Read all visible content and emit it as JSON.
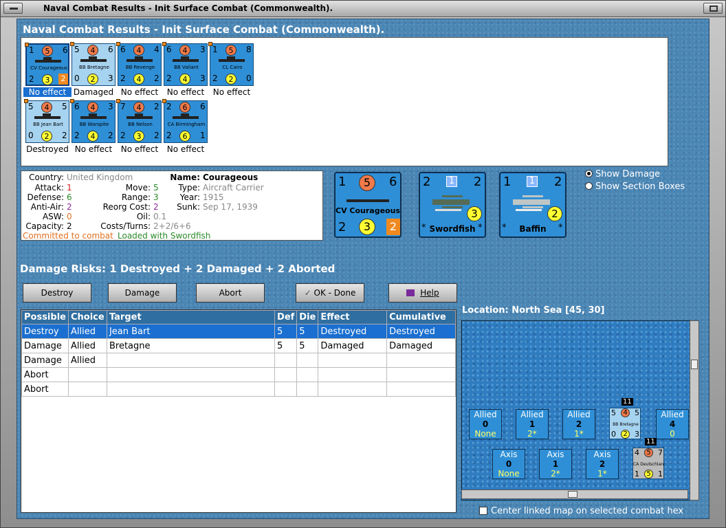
{
  "window": {
    "title": "Naval Combat Results - Init Surface Combat (Commonwealth)."
  },
  "panel_title": "Naval Combat Results - Init Surface Combat (Commonwealth).",
  "units": [
    {
      "tl": "1",
      "top": "5",
      "tr": "6",
      "name": "CV Courageous",
      "bl": "2",
      "mid": "3",
      "br": "2",
      "result": "No effect",
      "selected": true,
      "light": false
    },
    {
      "tl": "5",
      "top": "4",
      "tr": "6",
      "name": "BB Bretagne",
      "bl": "0",
      "mid": "2",
      "br": "3",
      "result": "Damaged",
      "selected": false,
      "light": true
    },
    {
      "tl": "6",
      "top": "4",
      "tr": "4",
      "name": "BB Revenge",
      "bl": "2",
      "mid": "4",
      "br": "2",
      "result": "No effect",
      "selected": false,
      "light": false
    },
    {
      "tl": "6",
      "top": "4",
      "tr": "3",
      "name": "BB Valiant",
      "bl": "2",
      "mid": "4",
      "br": "3",
      "result": "No effect",
      "selected": false,
      "light": false
    },
    {
      "tl": "1",
      "top": "5",
      "tr": "8",
      "name": "CL Cairo",
      "bl": "2",
      "mid": "2",
      "br": "0",
      "result": "No effect",
      "selected": false,
      "light": false
    },
    {
      "tl": "5",
      "top": "4",
      "tr": "5",
      "name": "BB Jean Bart",
      "bl": "0",
      "mid": "2",
      "br": "2",
      "result": "Destroyed",
      "selected": false,
      "light": true
    },
    {
      "tl": "6",
      "top": "4",
      "tr": "3",
      "name": "BB Warspite",
      "bl": "2",
      "mid": "4",
      "br": "2",
      "result": "No effect",
      "selected": false,
      "light": false
    },
    {
      "tl": "7",
      "top": "4",
      "tr": "2",
      "name": "BB Nelson",
      "bl": "2",
      "mid": "3",
      "br": "2",
      "result": "No effect",
      "selected": false,
      "light": false
    },
    {
      "tl": "2",
      "top": "6",
      "tr": "6",
      "name": "CA Birmingham",
      "bl": "2",
      "mid": "6",
      "br": "1",
      "result": "No effect",
      "selected": false,
      "light": false
    }
  ],
  "info": {
    "country_label": "Country:",
    "country": "United Kingdom",
    "attack_label": "Attack:",
    "attack": "1",
    "defense_label": "Defense:",
    "defense": "6",
    "antiair_label": "Anti-Air:",
    "antiair": "2",
    "asw_label": "ASW:",
    "asw": "0",
    "capacity_label": "Capacity:",
    "capacity": "2",
    "name_label": "Name:",
    "name": "Courageous",
    "move_label": "Move:",
    "move": "5",
    "type_label": "Type:",
    "type": "Aircraft Carrier",
    "range_label": "Range:",
    "range": "3",
    "year_label": "Year:",
    "year": "1915",
    "reorg_label": "Reorg Cost:",
    "reorg": "2",
    "sunk_label": "Sunk:",
    "sunk": "Sep 17, 1939",
    "oil_label": "Oil:",
    "oil": "0.1",
    "costs_label": "Costs/Turns:",
    "costs": "2+2/6+6",
    "status_committed": "Committed to combat",
    "status_loaded": "Loaded with Swordfish"
  },
  "big_cards": {
    "ship": {
      "tl": "1",
      "top": "5",
      "tr": "6",
      "name": "CV Courageous",
      "bl": "2",
      "mid": "3",
      "br": "2"
    },
    "plane1": {
      "tl": "2",
      "top": "1",
      "tr": "2",
      "name": "Swordfish",
      "mid": "3",
      "bl": "*",
      "br": "*"
    },
    "plane2": {
      "tl": "1",
      "top": "1",
      "tr": "2",
      "name": "Baffin",
      "mid": "2",
      "bl": "*",
      "br": "*"
    }
  },
  "options": {
    "show_damage": "Show Damage",
    "show_section_boxes": "Show Section Boxes",
    "selected": "show_damage"
  },
  "risks": "Damage Risks: 1 Destroyed + 2 Damaged + 2 Aborted",
  "buttons": {
    "destroy": "Destroy",
    "damage": "Damage",
    "abort": "Abort",
    "ok": "OK - Done",
    "help": "Help"
  },
  "table": {
    "headers": [
      "Possible",
      "Choice",
      "Target",
      "Def",
      "Die",
      "Effect",
      "Cumulative"
    ],
    "rows": [
      [
        "Destroy",
        "Allied",
        "Jean Bart",
        "5",
        "5",
        "Destroyed",
        "Destroyed"
      ],
      [
        "Damage",
        "Allied",
        "Bretagne",
        "5",
        "5",
        "Damaged",
        "Damaged"
      ],
      [
        "Damage",
        "Allied",
        "",
        "",
        "",
        "",
        ""
      ],
      [
        "Abort",
        "",
        "",
        "",
        "",
        "",
        ""
      ],
      [
        "Abort",
        "",
        "",
        "",
        "",
        "",
        ""
      ]
    ],
    "selected_row": 0
  },
  "location": "Location:  North Sea [45, 30]",
  "map": {
    "allied_boxes": [
      {
        "side": "Allied",
        "num": "0",
        "val": "None"
      },
      {
        "side": "Allied",
        "num": "1",
        "val": "2*"
      },
      {
        "side": "Allied",
        "num": "2",
        "val": "1*"
      },
      {
        "side": "Allied",
        "num": "4",
        "val": "0"
      }
    ],
    "axis_boxes": [
      {
        "side": "Axis",
        "num": "0",
        "val": "None"
      },
      {
        "side": "Axis",
        "num": "1",
        "val": "2*"
      },
      {
        "side": "Axis",
        "num": "2",
        "val": "1*"
      }
    ],
    "allied_unit": {
      "badge": "11",
      "tl": "5",
      "top": "4",
      "tr": "5",
      "name": "BB Bretagne",
      "bl": "0",
      "mid": "2",
      "br": "3"
    },
    "axis_unit": {
      "badge": "11",
      "tl": "4",
      "top": "5",
      "tr": "7",
      "name": "CA Deutschland",
      "bl": "1",
      "mid": "5",
      "br": "1"
    }
  },
  "center_map_label": "Center linked map on selected combat hex"
}
